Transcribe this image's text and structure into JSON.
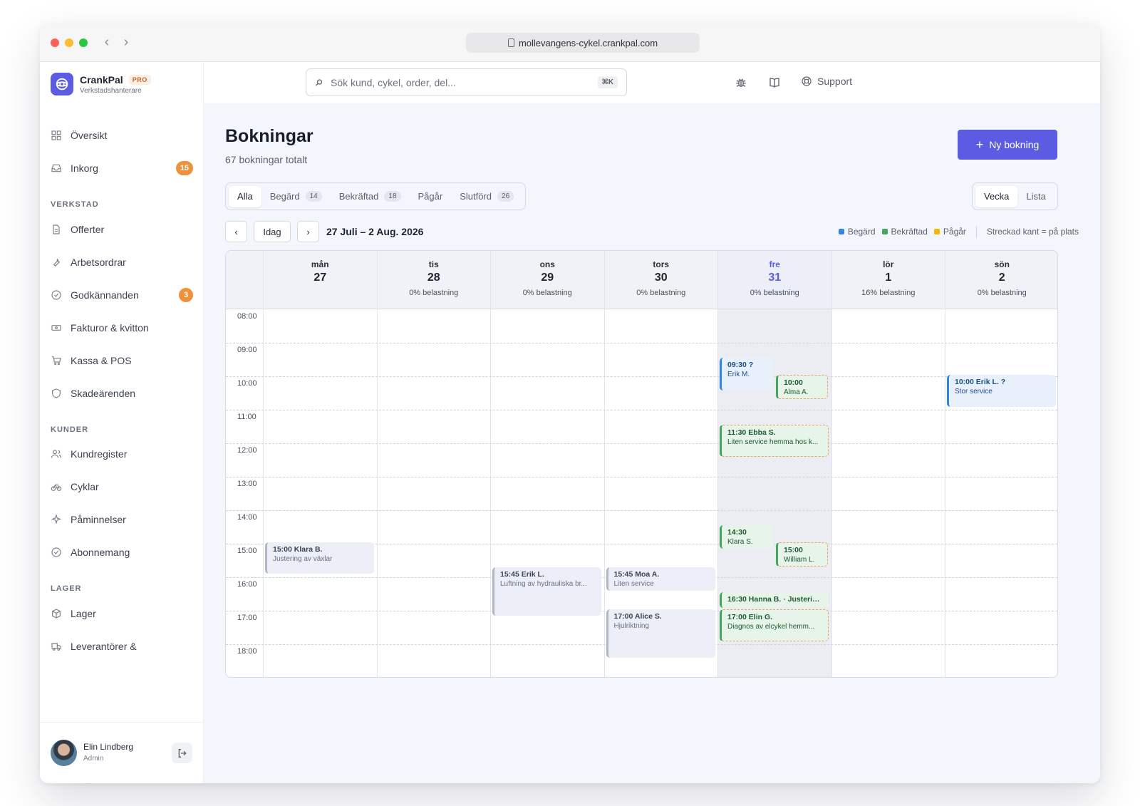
{
  "browser": {
    "url": "mollevangens-cykel.crankpal.com",
    "traffic_lights": [
      "#ff5f57",
      "#febc2e",
      "#28c840"
    ]
  },
  "brand": {
    "name": "CrankPal",
    "badge": "PRO",
    "subtitle": "Verkstadshanterare",
    "accent": "#5b5ce2"
  },
  "sidebar": {
    "top_items": [
      {
        "label": "Översikt",
        "icon": "grid-icon"
      },
      {
        "label": "Inkorg",
        "icon": "inbox-icon",
        "badge": "15"
      }
    ],
    "sections": [
      {
        "title": "VERKSTAD",
        "items": [
          {
            "label": "Offerter",
            "icon": "document-icon"
          },
          {
            "label": "Arbetsordrar",
            "icon": "wrench-icon"
          },
          {
            "label": "Godkännanden",
            "icon": "check-circle-icon",
            "badge": "3"
          },
          {
            "label": "Fakturor & kvitton",
            "icon": "banknote-icon"
          },
          {
            "label": "Kassa & POS",
            "icon": "cart-icon"
          },
          {
            "label": "Skadeärenden",
            "icon": "shield-icon"
          }
        ]
      },
      {
        "title": "KUNDER",
        "items": [
          {
            "label": "Kundregister",
            "icon": "users-icon"
          },
          {
            "label": "Cyklar",
            "icon": "bike-icon"
          },
          {
            "label": "Påminnelser",
            "icon": "sparkle-icon"
          },
          {
            "label": "Abonnemang",
            "icon": "check-circle-icon"
          }
        ]
      },
      {
        "title": "LAGER",
        "items": [
          {
            "label": "Lager",
            "icon": "box-icon"
          },
          {
            "label": "Leverantörer &",
            "icon": "truck-icon"
          }
        ]
      }
    ]
  },
  "user": {
    "name": "Elin Lindberg",
    "role": "Admin"
  },
  "topbar": {
    "search_placeholder": "Sök kund, cykel, order, del...",
    "shortcut": "⌘K",
    "support_label": "Support"
  },
  "page": {
    "title": "Bokningar",
    "subtitle": "67 bokningar totalt",
    "new_button": "Ny bokning"
  },
  "filter_tabs": [
    {
      "label": "Alla",
      "active": true
    },
    {
      "label": "Begärd",
      "count": "14"
    },
    {
      "label": "Bekräftad",
      "count": "18"
    },
    {
      "label": "Pågår"
    },
    {
      "label": "Slutförd",
      "count": "26"
    }
  ],
  "view_toggle": [
    {
      "label": "Vecka",
      "active": true
    },
    {
      "label": "Lista"
    }
  ],
  "week_nav": {
    "prev": "‹",
    "today": "Idag",
    "next": "›",
    "range": "27 Juli – 2 Aug. 2026"
  },
  "legend": {
    "items": [
      {
        "label": "Begärd",
        "color": "#2f86e8"
      },
      {
        "label": "Bekräftad",
        "color": "#45a55d"
      },
      {
        "label": "Pågår",
        "color": "#f5b800"
      }
    ],
    "note": "Streckad kant = på plats"
  },
  "calendar": {
    "hours": [
      "08:00",
      "09:00",
      "10:00",
      "11:00",
      "12:00",
      "13:00",
      "14:00",
      "15:00",
      "16:00",
      "17:00",
      "18:00"
    ],
    "days": [
      {
        "name": "mån",
        "num": "27",
        "load": ""
      },
      {
        "name": "tis",
        "num": "28",
        "load": "0% belastning"
      },
      {
        "name": "ons",
        "num": "29",
        "load": "0% belastning"
      },
      {
        "name": "tors",
        "num": "30",
        "load": "0% belastning"
      },
      {
        "name": "fre",
        "num": "31",
        "load": "0% belastning",
        "today": true
      },
      {
        "name": "lör",
        "num": "1",
        "load": "16% belastning"
      },
      {
        "name": "sön",
        "num": "2",
        "load": "0% belastning"
      }
    ],
    "events": [
      {
        "day": 0,
        "title": "15:00 Klara B.",
        "desc": "Justering av växlar",
        "style": "grey"
      },
      {
        "day": 2,
        "title": "15:45 Erik L.",
        "desc": "Luftning av hydrauliska br...",
        "style": "grey"
      },
      {
        "day": 3,
        "title": "15:45 Moa A.",
        "desc": "Liten service",
        "style": "grey"
      },
      {
        "day": 3,
        "title": "17:00 Alice S.",
        "desc": "Hjulriktning",
        "style": "grey"
      },
      {
        "day": 4,
        "title": "09:30 ?",
        "desc": "Erik M.",
        "style": "req"
      },
      {
        "day": 4,
        "title": "10:00",
        "desc": "Alma A.",
        "style": "conf",
        "onsite": true
      },
      {
        "day": 4,
        "title": "11:30 Ebba S.",
        "desc": "Liten service hemma hos k...",
        "style": "conf",
        "onsite": true
      },
      {
        "day": 4,
        "title": "14:30",
        "desc": "Klara S.",
        "style": "conf"
      },
      {
        "day": 4,
        "title": "15:00",
        "desc": "William L.",
        "style": "conf",
        "onsite": true
      },
      {
        "day": 4,
        "title": "16:30 Hanna B. · Justerin...",
        "desc": "",
        "style": "conf"
      },
      {
        "day": 4,
        "title": "17:00 Elin G.",
        "desc": "Diagnos av elcykel hemm...",
        "style": "conf",
        "onsite": true
      },
      {
        "day": 6,
        "title": "10:00 Erik L. ?",
        "desc": "Stor service",
        "style": "req"
      }
    ]
  }
}
